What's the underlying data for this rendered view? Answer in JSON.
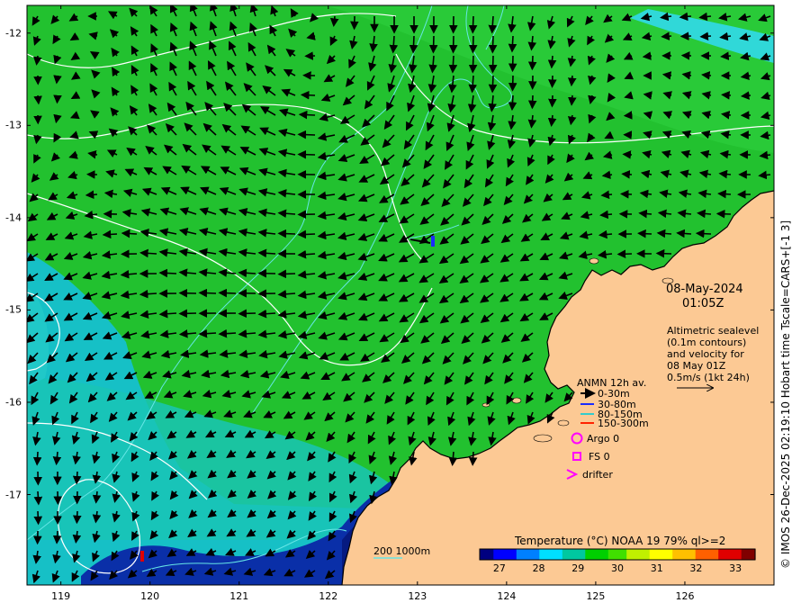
{
  "axes": {
    "x_ticks": [
      "119",
      "120",
      "121",
      "122",
      "123",
      "124",
      "125",
      "126"
    ],
    "y_ticks": [
      "-12",
      "-13",
      "-14",
      "-15",
      "-16",
      "-17"
    ]
  },
  "date_text": "08-May-2024",
  "time_text": "01:05Z",
  "altimetry_note": [
    "Altimetric sealevel",
    "(0.1m contours)",
    "and velocity for",
    "08 May 01Z",
    "0.5m/s (1kt 24h)"
  ],
  "mooring_legend": {
    "title": "ANMN 12h av.",
    "entries": [
      {
        "label": "0-30m",
        "color": "#000000"
      },
      {
        "label": "30-80m",
        "color": "#1a2bff"
      },
      {
        "label": "80-150m",
        "color": "#33cccc"
      },
      {
        "label": "150-300m",
        "color": "#ff2200"
      }
    ]
  },
  "marker_legend": [
    {
      "label": "Argo 0",
      "symbol": "circle-icon",
      "color": "#ff00ff"
    },
    {
      "label": "FS 0",
      "symbol": "square-icon",
      "color": "#ff00ff"
    },
    {
      "label": "drifter",
      "symbol": "chevron-icon",
      "color": "#ff00ff"
    }
  ],
  "colorbar": {
    "title": "Temperature (°C) NOAA 19 79% ql>=2",
    "ticks": [
      "27",
      "28",
      "29",
      "30",
      "31",
      "32",
      "33"
    ],
    "range": [
      26.5,
      33.5
    ],
    "palette": [
      "#000080",
      "#0000ff",
      "#0080ff",
      "#00e0ff",
      "#00c8a0",
      "#00d000",
      "#40e000",
      "#c0f000",
      "#ffff00",
      "#ffc000",
      "#ff6000",
      "#e00000",
      "#800000"
    ]
  },
  "depth_legend": "200  1000m",
  "credit": "© IMOS 26-Dec-2025 02:19:10 Hobart time Tscale=CARS+[-1 3]",
  "colors": {
    "land": "#fcc994",
    "ocean_warm": "#22c12f",
    "ocean_cool": "#16c0c6",
    "shelf_water": "#0a2fa8",
    "contour": "#ffffff",
    "isobath": "#66e6e6"
  },
  "map_extent": {
    "lon": [
      118.62,
      127.0
    ],
    "lat": [
      -17.98,
      -11.7
    ]
  }
}
